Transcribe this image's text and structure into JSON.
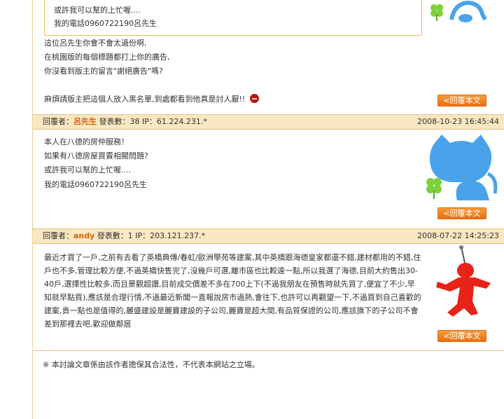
{
  "post1": {
    "quote_lines": [
      "或許我可以幫的上忙喔....",
      "我的電話0960722190呂先生"
    ],
    "lines": [
      "這位呂先生你會不會太過份啊,",
      "在桃園版的每個標題都打上你的廣告,",
      "你沒看到版主的留言\"謝絕廣告\"嗎?",
      "",
      "麻煩請版主把這個人放入黑名單,到處都看到他真是討人厭!!"
    ]
  },
  "reply_label": "<回覆本文",
  "reply2": {
    "prefix": "回覆者：",
    "author": "呂先生",
    "stats": " 發表數：38 IP：61.224.231.*",
    "date": "2008-10-23 16:45:44",
    "lines": [
      "本人在八德的房仲服務！",
      "如果有八德房屋買賣相關問題?",
      "或許我可以幫的上忙喔....",
      "我的電話0960722190呂先生"
    ]
  },
  "reply3": {
    "prefix": "回覆者：",
    "author": "andy",
    "stats": " 發表數：1 IP：203.121.237.*",
    "date": "2008-07-22 14:25:23",
    "text": "最近才買了一戶,之前有去看了英橋典傳/春虹/歐洲學苑等建案,其中英橋跟海德皇家都還不錯,建材都用的不錯,住戶也不多,管理比較方便,不過英橋快售完了,沒幾戶可選,離市區也比較遠一點,所以我選了海德,目前大約售出30-40戶,選擇性比較多,而且景觀超讚,目前成交價差不多在700上下(不過我朋友在預售時就先買了,便宜了不少,早知就早點買),應該是合理行情,不過最近新聞一直報說房市過熱,會往下,也許可以再觀望一下,不過買到自己喜歡的建案,貴一點也是值得的,麗盛建設是麗寶建設的子公司,麗寶是超大間,有品質保證的公司,應該旗下的子公司不會差到那裡去吧,歡迎做鄰居"
  },
  "footer": {
    "notice": "※ 本討論文章係由該作者擔保其合法性，不代表本網站之立場。"
  },
  "colors": {
    "accent": "#e96f11",
    "header_bg": "#f9e7c2",
    "author": "#d9610a"
  }
}
